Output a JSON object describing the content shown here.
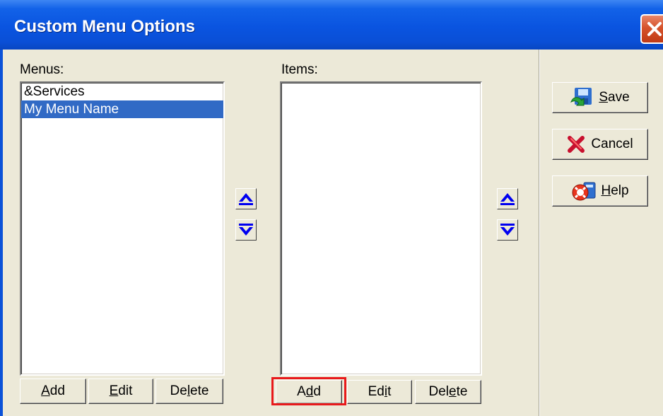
{
  "window": {
    "title": "Custom Menu Options"
  },
  "menus": {
    "label": "Menus:",
    "items": [
      {
        "label": "&Services",
        "selected": false
      },
      {
        "label": "My Menu Name",
        "selected": true
      }
    ],
    "buttons": {
      "add": {
        "pre": "",
        "u": "A",
        "post": "dd"
      },
      "edit": {
        "pre": "",
        "u": "E",
        "post": "dit"
      },
      "delete": {
        "pre": "De",
        "u": "l",
        "post": "ete"
      }
    }
  },
  "items_panel": {
    "label": "Items:",
    "items": [],
    "buttons": {
      "add": {
        "pre": "A",
        "u": "d",
        "post": "d"
      },
      "edit": {
        "pre": "Ed",
        "u": "i",
        "post": "t"
      },
      "delete": {
        "pre": "Del",
        "u": "e",
        "post": "te"
      }
    }
  },
  "actions": {
    "save": {
      "pre": "",
      "u": "S",
      "post": "ave",
      "icon": "save-icon"
    },
    "cancel": {
      "pre": "Cancel",
      "u": "",
      "post": "",
      "icon": "cancel-icon"
    },
    "help": {
      "pre": "",
      "u": "H",
      "post": "elp",
      "icon": "help-icon"
    }
  },
  "colors": {
    "titlebar": "#0a54e0",
    "selection": "#316ac5",
    "arrow": "#0000f0",
    "highlight": "#e8191b",
    "close": "#d6532c"
  }
}
